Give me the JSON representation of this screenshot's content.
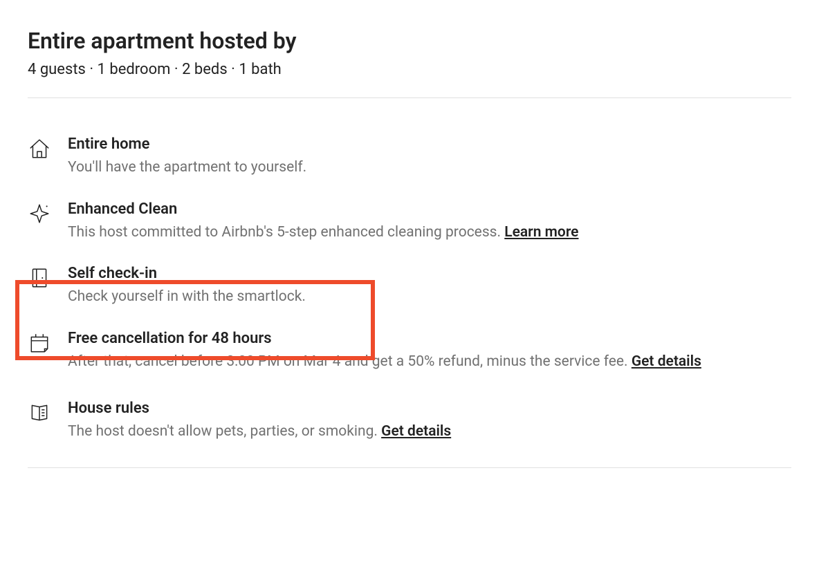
{
  "header": {
    "title": "Entire apartment hosted by",
    "subtitle_parts": [
      "4 guests",
      "1 bedroom",
      "2 beds",
      "1 bath"
    ],
    "subtitle_joined": "4 guests · 1 bedroom · 2 beds · 1 bath"
  },
  "features": [
    {
      "icon": "home-icon",
      "title": "Entire home",
      "desc": "You'll have the apartment to yourself.",
      "link": null
    },
    {
      "icon": "sparkle-icon",
      "title": "Enhanced Clean",
      "desc": "This host committed to Airbnb's 5-step enhanced cleaning process. ",
      "link": "Learn more"
    },
    {
      "icon": "door-icon",
      "title": "Self check-in",
      "desc": "Check yourself in with the smartlock.",
      "link": null,
      "highlighted": true
    },
    {
      "icon": "calendar-icon",
      "title": "Free cancellation for 48 hours",
      "desc": "After that, cancel before 3:00 PM on Mar 4 and get a 50% refund, minus the service fee. ",
      "link": "Get details"
    },
    {
      "icon": "rules-icon",
      "title": "House rules",
      "desc": "The host doesn't allow pets, parties, or smoking. ",
      "link": "Get details"
    }
  ],
  "highlight_color": "#ee4b2b"
}
